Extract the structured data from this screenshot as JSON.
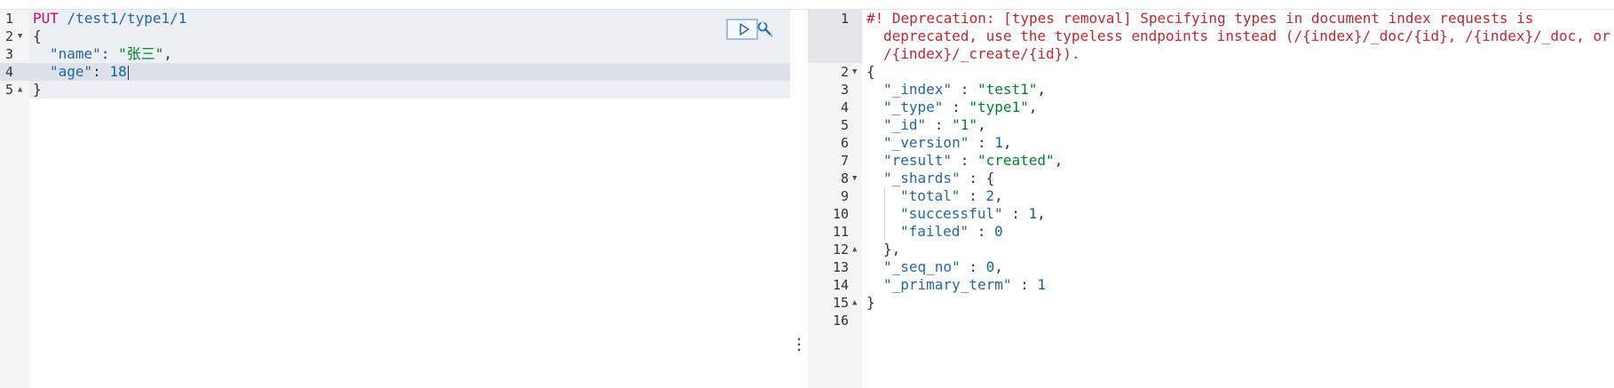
{
  "request": {
    "gutter": [
      "1",
      "2",
      "3",
      "4",
      "5"
    ],
    "method": "PUT",
    "url": "/test1/type1/1",
    "open_brace": "{",
    "close_brace": "}",
    "fields": [
      {
        "key": "\"name\"",
        "colon": ": ",
        "value": "\"张三\"",
        "comma": ","
      },
      {
        "key": "\"age\"",
        "colon": ": ",
        "value": "18",
        "comma": ""
      }
    ],
    "send_action": "play-icon",
    "settings_action": "wrench-icon"
  },
  "response": {
    "gutter": [
      "1",
      "2",
      "3",
      "4",
      "5",
      "6",
      "7",
      "8",
      "9",
      "10",
      "11",
      "12",
      "13",
      "14",
      "15",
      "16"
    ],
    "warning_lines": [
      "#! Deprecation: [types removal] Specifying types in document index requests is",
      "deprecated, use the typeless endpoints instead (/{index}/_doc/{id}, /{index}/_doc, or",
      "/{index}/_create/{id})."
    ],
    "open_brace": "{",
    "close_brace": "}",
    "fields": [
      {
        "key": "\"_index\"",
        "sep": " : ",
        "value": "\"test1\"",
        "comma": ",",
        "type": "str"
      },
      {
        "key": "\"_type\"",
        "sep": " : ",
        "value": "\"type1\"",
        "comma": ",",
        "type": "str"
      },
      {
        "key": "\"_id\"",
        "sep": " : ",
        "value": "\"1\"",
        "comma": ",",
        "type": "str"
      },
      {
        "key": "\"_version\"",
        "sep": " : ",
        "value": "1",
        "comma": ",",
        "type": "num"
      },
      {
        "key": "\"result\"",
        "sep": " : ",
        "value": "\"created\"",
        "comma": ",",
        "type": "str"
      }
    ],
    "shards": {
      "key": "\"_shards\"",
      "sep": " : ",
      "open": "{",
      "close": "},",
      "items": [
        {
          "key": "\"total\"",
          "sep": " : ",
          "value": "2",
          "comma": ","
        },
        {
          "key": "\"successful\"",
          "sep": " : ",
          "value": "1",
          "comma": ","
        },
        {
          "key": "\"failed\"",
          "sep": " : ",
          "value": "0",
          "comma": ""
        }
      ]
    },
    "tail_fields": [
      {
        "key": "\"_seq_no\"",
        "sep": " : ",
        "value": "0",
        "comma": ","
      },
      {
        "key": "\"_primary_term\"",
        "sep": " : ",
        "value": "1",
        "comma": ""
      }
    ]
  },
  "colors": {
    "method": "#c80a68",
    "url": "#2466a7",
    "string": "#00822a",
    "number": "#0b65a0",
    "warning": "#bd2830"
  }
}
